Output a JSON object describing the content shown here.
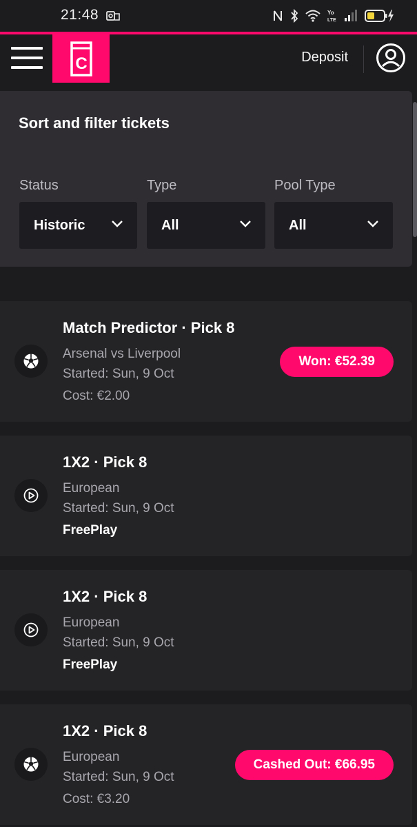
{
  "status_bar": {
    "time": "21:48",
    "icons": [
      "outlook-notification-icon",
      "nfc-icon",
      "bluetooth-icon",
      "wifi-icon",
      "volte-icon",
      "signal-icon",
      "battery-charging-icon"
    ]
  },
  "header": {
    "logo_letter": "C",
    "deposit_label": "Deposit",
    "accent_color": "#ff0a6c"
  },
  "filters": {
    "title": "Sort and filter tickets",
    "status": {
      "label": "Status",
      "value": "Historic"
    },
    "type": {
      "label": "Type",
      "value": "All"
    },
    "pool_type": {
      "label": "Pool Type",
      "value": "All"
    }
  },
  "tickets": [
    {
      "icon": "soccer-ball-icon",
      "title": "Match Predictor · Pick 8",
      "line1": "Arsenal vs Liverpool",
      "line2": "Started: Sun, 9 Oct",
      "line3": "Cost: €2.00",
      "badge": "Won: €52.39"
    },
    {
      "icon": "play-circle-icon",
      "title": "1X2 · Pick 8",
      "line1": "European",
      "line2": "Started: Sun, 9 Oct",
      "line3": "FreePlay"
    },
    {
      "icon": "play-circle-icon",
      "title": "1X2 · Pick 8",
      "line1": "European",
      "line2": "Started: Sun, 9 Oct",
      "line3": "FreePlay"
    },
    {
      "icon": "soccer-ball-icon",
      "title": "1X2 · Pick 8",
      "line1": "European",
      "line2": "Started: Sun, 9 Oct",
      "line3": "Cost: €3.20",
      "badge": "Cashed Out: €66.95"
    }
  ]
}
